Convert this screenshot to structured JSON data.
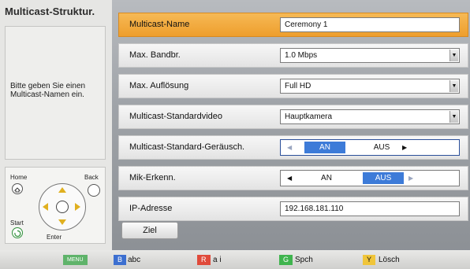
{
  "sidebar": {
    "title": "Multicast-Struktur.",
    "help": "Bitte geben Sie einen Multicast-Namen ein.",
    "remote": {
      "home": "Home",
      "back": "Back",
      "start": "Start",
      "enter": "Enter"
    }
  },
  "form": {
    "rows": [
      {
        "label": "Multicast-Name",
        "value": "Ceremony 1"
      },
      {
        "label": "Max. Bandbr.",
        "value": "1.0 Mbps"
      },
      {
        "label": "Max. Auflösung",
        "value": "Full HD"
      },
      {
        "label": "Multicast-Standardvideo",
        "value": "Hauptkamera"
      },
      {
        "label": "Multicast-Standard-Geräusch.",
        "on": "AN",
        "off": "AUS",
        "selected": "AN"
      },
      {
        "label": "Mik-Erkenn.",
        "on": "AN",
        "off": "AUS",
        "selected": "AUS"
      },
      {
        "label": "IP-Adresse",
        "value": "192.168.181.110"
      }
    ],
    "target_button": "Ziel"
  },
  "footer": {
    "keys": [
      {
        "key": "MENU",
        "label": "",
        "color": "#5fb36a"
      },
      {
        "key": "B",
        "label": "abc",
        "color": "#3c6fd0"
      },
      {
        "key": "R",
        "label": "a i",
        "color": "#e04a3a"
      },
      {
        "key": "G",
        "label": "Spch",
        "color": "#3fb44e"
      },
      {
        "key": "Y",
        "label": "Lösch",
        "color": "#f0c53a"
      }
    ]
  },
  "colors": {
    "active_row": "#f0a43a",
    "selected_toggle": "#3d7bd8"
  }
}
